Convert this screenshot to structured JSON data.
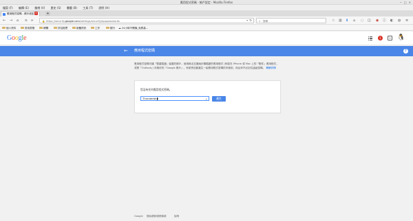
{
  "window": {
    "title": "應用程式密碼 - 帳戶設定 - Mozilla Firefox",
    "controls": [
      "−",
      "□",
      "×"
    ]
  },
  "menubar": {
    "items": [
      "檔案 (F)",
      "編輯 (E)",
      "檢視 (V)",
      "歷史 (S)",
      "書籤 (B)",
      "工具 (T)",
      "說明 (H)"
    ]
  },
  "tabs": [
    {
      "label": "應用程式密碼 - 帳戶設定",
      "close": "×"
    }
  ],
  "newtab": "+",
  "navigation": {
    "back": "←",
    "forward": "→",
    "home": "⌂",
    "url_prefix": "https://security.",
    "url_domain": "google.com",
    "url_suffix": "/settings/security/apppasswords",
    "search_placeholder": "搜尋"
  },
  "bookmarks": [
    {
      "label": "個人資料",
      "icon": "folder-icon"
    },
    {
      "label": "常用書籤",
      "icon": "folder-icon"
    },
    {
      "label": "網購",
      "icon": "folder-icon"
    },
    {
      "label": "好站推薦",
      "icon": "folder-icon"
    },
    {
      "label": "軟體資訊",
      "icon": "folder-icon"
    },
    {
      "label": "工作",
      "icon": "folder-icon"
    },
    {
      "label": "銀行",
      "icon": "folder-icon"
    },
    {
      "label": "24小時不關機_免費高...",
      "icon": "site-icon"
    }
  ],
  "google": {
    "logo_letters": [
      {
        "ch": "G",
        "cls": "b"
      },
      {
        "ch": "o",
        "cls": "r"
      },
      {
        "ch": "o",
        "cls": "y"
      },
      {
        "ch": "g",
        "cls": "b"
      },
      {
        "ch": "l",
        "cls": "g"
      },
      {
        "ch": "e",
        "cls": "r"
      }
    ],
    "notification_count": "1",
    "accent_color": "#4a86e8"
  },
  "page": {
    "title": "應用程式密碼",
    "description": "應用程式密碼可讓「雙重驗證」保護的帳戶，使用無法支援兩步驟驗證的應用程式 (例如在 iPhone 或 Mac 上的「郵件」應用程式，或是「Outlook」) 存取你的「Google 帳戶」。系統會自動產生一組應用程式密碼供你使用，而且你不必記住這組密碼。",
    "learn_more": "瞭解詳情",
    "no_passwords_msg": "您沒有任何應用程式密碼。",
    "app_name_value": "Thunderbird",
    "generate_button": "產生"
  },
  "footer": {
    "items": [
      "Google",
      "隱私權和服務條款",
      "說明"
    ]
  }
}
